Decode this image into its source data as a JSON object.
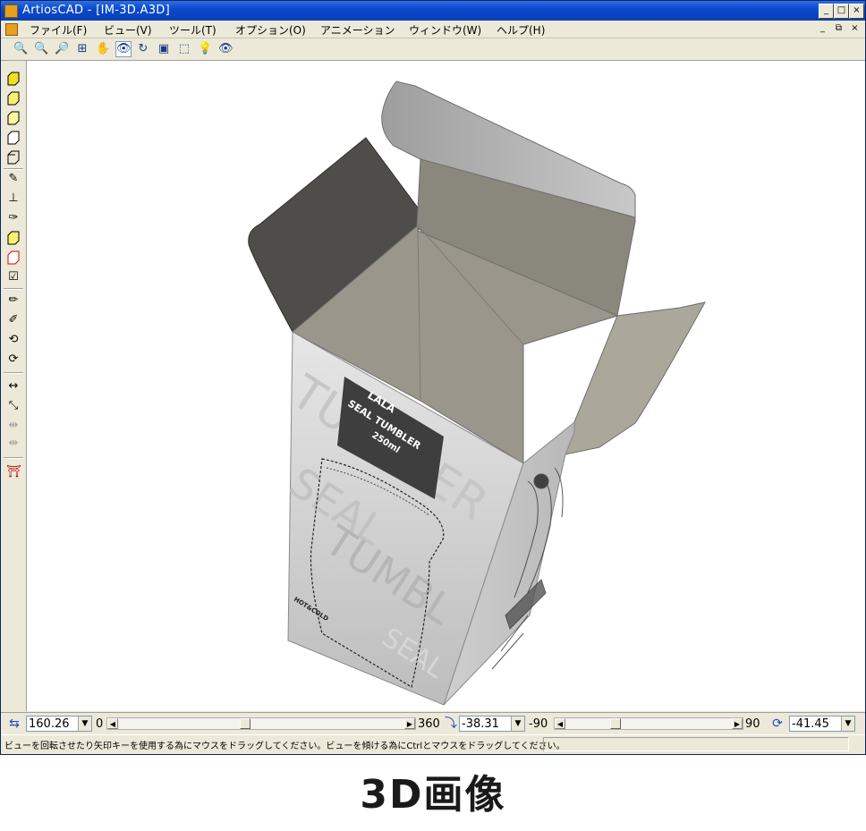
{
  "window": {
    "title": "ArtiosCAD - [IM-3D.A3D]",
    "controls": [
      "_",
      "□",
      "×"
    ]
  },
  "menubar": {
    "items": [
      "ファイル(F)",
      "ビュー(V)",
      "ツール(T)",
      "オプション(O)",
      "アニメーション",
      "ウィンドウ(W)",
      "ヘルプ(H)"
    ],
    "mdi_controls": [
      "_",
      "⧉",
      "×"
    ]
  },
  "bottom": {
    "rotation_combo": "160.26",
    "rotation_min": "0",
    "rotation_max": "360",
    "rotation_position": 0.44,
    "tilt_combo": "-38.31",
    "tilt_min": "-90",
    "tilt_max": "90",
    "tilt_position": 0.29,
    "spin_combo": "-41.45"
  },
  "status": {
    "text": "ビューを回転させたり矢印キーを使用する為にマウスをドラッグしてください。ビューを傾ける為にCtrlとマウスをドラッグしてください。"
  },
  "box": {
    "panel_lines": [
      "LALA",
      "SEAL TUMBLER",
      "250ml"
    ],
    "wm_front_1": "TUMBLER",
    "wm_front_2": "SEAL",
    "wm_front_3": "TUMBL",
    "wm_front_4": "SEAL",
    "brand": "HOT&COLD"
  },
  "caption": "3D画像"
}
